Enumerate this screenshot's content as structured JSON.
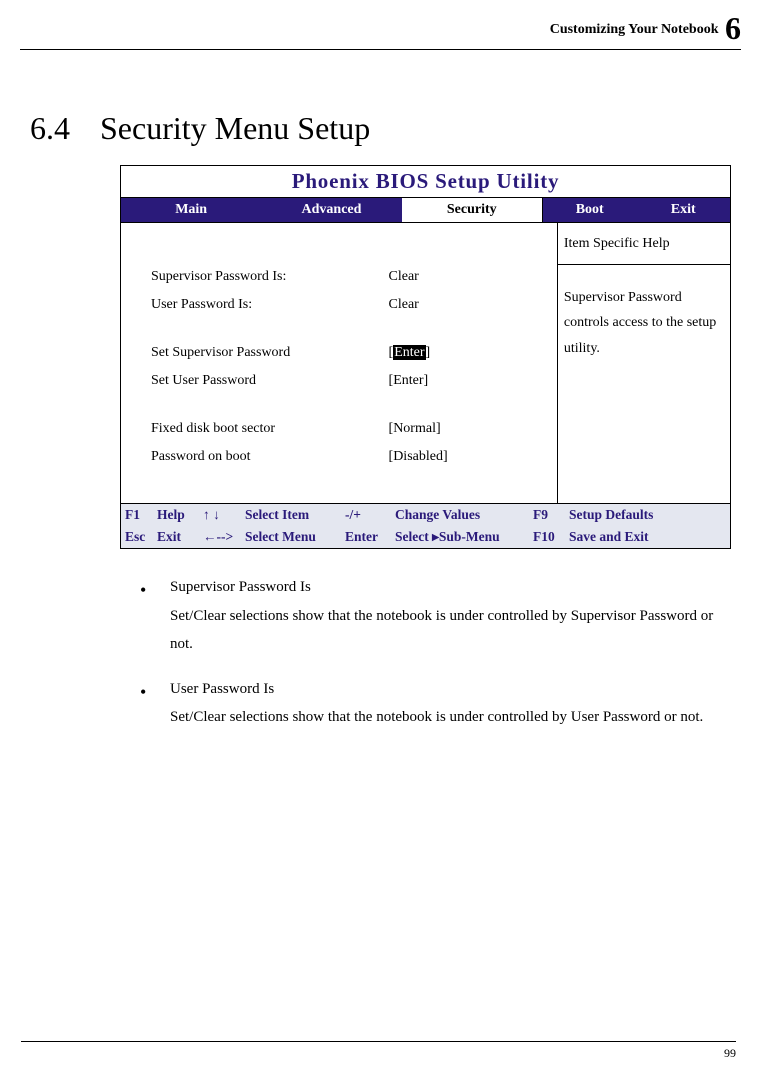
{
  "header": {
    "running": "Customizing Your Notebook",
    "chapter_num": "6"
  },
  "section": {
    "number": "6.4",
    "title": "Security Menu Setup"
  },
  "bios": {
    "title": "Phoenix BIOS Setup Utility",
    "tabs": {
      "main": "Main",
      "advanced": "Advanced",
      "security": "Security",
      "boot": "Boot",
      "exit": "Exit"
    },
    "rows": {
      "sup_pw_label": "Supervisor Password Is:",
      "sup_pw_value": "Clear",
      "usr_pw_label": "User Password Is:",
      "usr_pw_value": "Clear",
      "set_sup_label": "Set Supervisor Password",
      "set_sup_value_open": "[",
      "set_sup_value_mid": "Enter",
      "set_sup_value_close": "]",
      "set_usr_label": "Set User Password",
      "set_usr_value": "[Enter]",
      "fixed_label": "Fixed disk boot sector",
      "fixed_value": "[Normal]",
      "pob_label": "Password on boot",
      "pob_value": "[Disabled]"
    },
    "help": {
      "title": "Item Specific Help",
      "body": "Supervisor Password controls access to the setup utility."
    },
    "footer": {
      "r1": {
        "k1": "F1",
        "l1": "Help",
        "a1": "↑ ↓",
        "b1": "Select Item",
        "c1": "-/+",
        "d1": "Change Values",
        "e1": "F9",
        "f1": "Setup Defaults"
      },
      "r2": {
        "k1": "Esc",
        "l1": "Exit",
        "a1": "←-->",
        "b1": "Select Menu",
        "c1": "Enter",
        "d1": "Select ▸Sub-Menu",
        "e1": "F10",
        "f1": "Save and Exit"
      }
    }
  },
  "bullets": {
    "b1_title": "Supervisor Password Is",
    "b1_body": "Set/Clear selections show that the notebook is under controlled by Supervisor Password or not.",
    "b2_title": "User Password Is",
    "b2_body": "Set/Clear selections show that the notebook is under controlled by User Password or not."
  },
  "page_number": "99"
}
